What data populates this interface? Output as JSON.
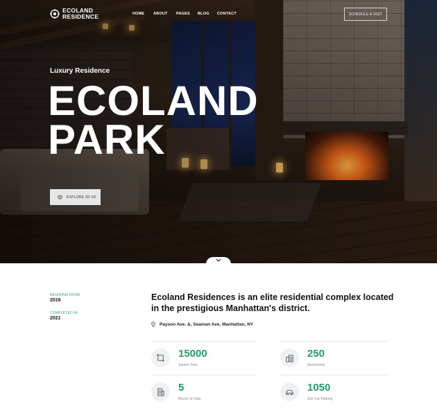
{
  "brand": {
    "line1": "ECOLAND",
    "line2": "RESIDENCE"
  },
  "nav": {
    "items": [
      {
        "label": "HOME"
      },
      {
        "label": "ABOUT"
      },
      {
        "label": "PAGES"
      },
      {
        "label": "BLOG"
      },
      {
        "label": "CONTACT"
      }
    ],
    "cta": "SCHEDULE A VISIT"
  },
  "hero": {
    "subtitle": "Luxury Residence",
    "title_line1": "ECOLAND",
    "title_line2": "PARK",
    "vr_button": "EXPLORE 3D VR"
  },
  "details": {
    "beginning_label": "BEGINING FROM",
    "beginning_value": "2016",
    "completed_label": "COMPLETED IN",
    "completed_value": "2021",
    "headline": "Ecoland Residences is an elite residential complex located in the prestigious Manhattan's district.",
    "address": "Payson Ave. &, Seaman Ave, Manhattan, NY"
  },
  "stats": [
    {
      "value": "15000",
      "label": "Square Feet",
      "icon": "area-icon"
    },
    {
      "value": "250",
      "label": "Apartments",
      "icon": "apartments-icon"
    },
    {
      "value": "5",
      "label": "Blocks of Flats",
      "icon": "building-icon"
    },
    {
      "value": "1050",
      "label": "Slot Car Parking",
      "icon": "parking-icon"
    }
  ],
  "colors": {
    "accent": "#1f9f63",
    "label_green": "#27a36b",
    "icon_bg": "#eef1f4"
  }
}
